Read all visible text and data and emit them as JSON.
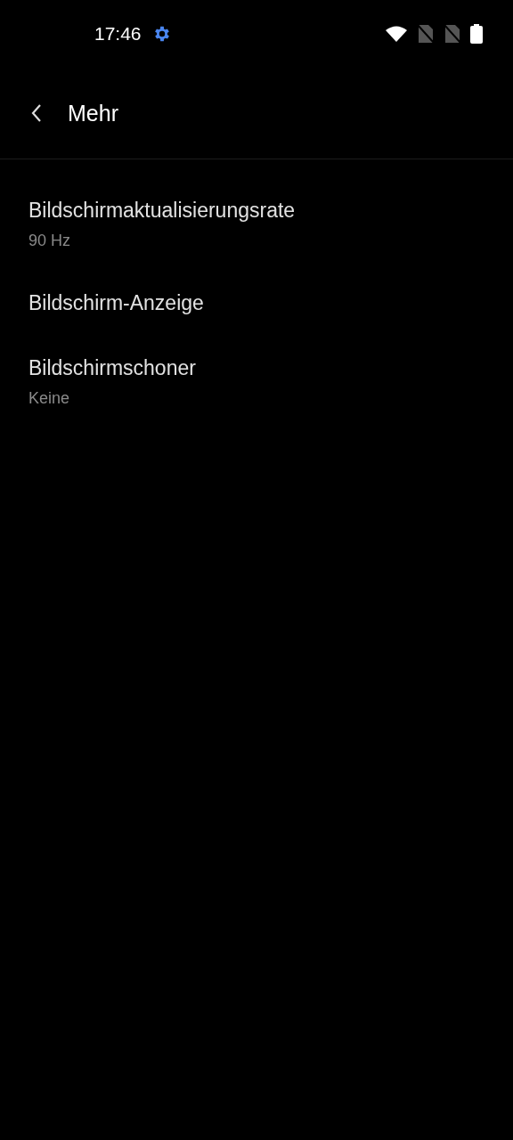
{
  "status_bar": {
    "time": "17:46"
  },
  "header": {
    "title": "Mehr"
  },
  "items": [
    {
      "title": "Bildschirmaktualisierungsrate",
      "subtitle": "90 Hz"
    },
    {
      "title": "Bildschirm-Anzeige"
    },
    {
      "title": "Bildschirmschoner",
      "subtitle": "Keine"
    }
  ]
}
